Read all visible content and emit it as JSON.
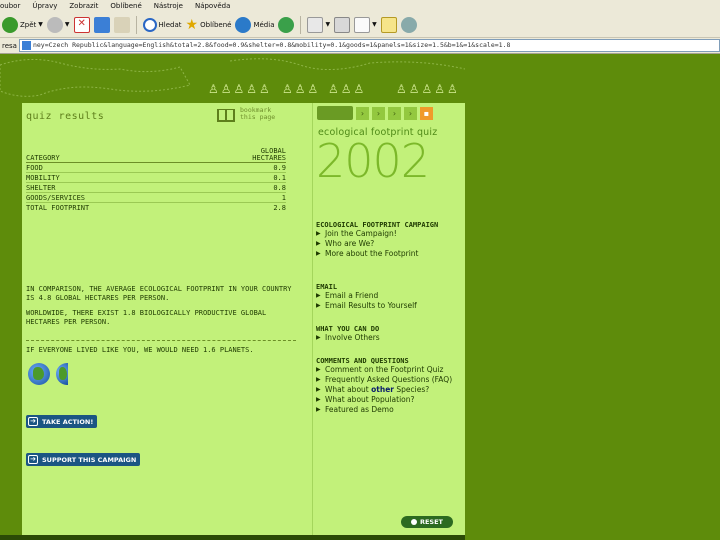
{
  "browser": {
    "menu": [
      "oubor",
      "Úpravy",
      "Zobrazit",
      "Oblíbené",
      "Nástroje",
      "Nápověda"
    ],
    "toolbar": {
      "back_label": "Zpět",
      "search_label": "Hledat",
      "favorites_label": "Oblíbené",
      "media_label": "Média"
    },
    "address_label": "resa",
    "address_value": "ney=Czech Republic&language=English&total=2.8&food=0.9&shelter=0.8&mobility=0.1&goods=1&panels=1&size=1.5&b=1&=1&scale=1.8"
  },
  "quiz": {
    "title": "quiz results",
    "bookmark_line1": "bookmark",
    "bookmark_line2": "this page",
    "col_category": "CATEGORY",
    "col_unit_line1": "GLOBAL",
    "col_unit_line2": "HECTARES",
    "rows": [
      {
        "label": "FOOD",
        "value": "0.9"
      },
      {
        "label": "MOBILITY",
        "value": "0.1"
      },
      {
        "label": "SHELTER",
        "value": "0.8"
      },
      {
        "label": "GOODS/SERVICES",
        "value": "1"
      },
      {
        "label": "TOTAL FOOTPRINT",
        "value": "2.8"
      }
    ],
    "comparison": "IN COMPARISON, THE AVERAGE ECOLOGICAL FOOTPRINT IN YOUR COUNTRY IS 4.8 GLOBAL HECTARES PER PERSON.",
    "worldwide": "WORLDWIDE, THERE EXIST 1.8 BIOLOGICALLY PRODUCTIVE GLOBAL HECTARES PER PERSON.",
    "planets": "IF EVERYONE LIVED LIKE YOU, WE WOULD NEED 1.6 PLANETS.",
    "take_action": "TAKE ACTION!",
    "support": "SUPPORT THIS CAMPAIGN"
  },
  "sidebar": {
    "label": "ecological footprint quiz",
    "year": "2002",
    "campaign_heading": "ECOLOGICAL FOOTPRINT CAMPAIGN",
    "campaign_links": [
      "Join the Campaign!",
      "Who are We?",
      "More about the Footprint"
    ],
    "email_heading": "EMAIL",
    "email_links": [
      "Email a Friend",
      "Email Results to Yourself"
    ],
    "whatyoucando_heading": "WHAT YOU CAN DO",
    "whatyoucando_links": [
      "Involve Others"
    ],
    "comments_heading": "COMMENTS AND QUESTIONS",
    "comments_links": [
      "Comment on the Footprint Quiz",
      "Frequently Asked Questions (FAQ)"
    ],
    "other_species_pre": "What about ",
    "other_species_hl": "other",
    "other_species_post": " Species?",
    "population": "What about Population?",
    "featured": "Featured as Demo",
    "reset": "RESET"
  },
  "colors": {
    "page_bg": "#5e8c0b",
    "panel_bg": "#c2f17a",
    "accent_orange": "#f09a2a",
    "button_blue": "#1b5583"
  }
}
